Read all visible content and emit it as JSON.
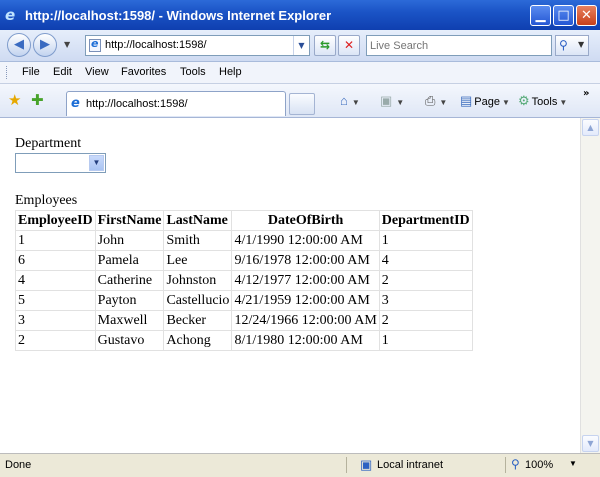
{
  "window": {
    "title": "http://localhost:1598/ - Windows Internet Explorer",
    "minimize_glyph": "▁",
    "maximize_glyph": "□",
    "close_glyph": "✕"
  },
  "address": {
    "url": "http://localhost:1598/",
    "search_placeholder": "Live Search"
  },
  "menu": {
    "file": "File",
    "edit": "Edit",
    "view": "View",
    "favorites": "Favorites",
    "tools": "Tools",
    "help": "Help"
  },
  "tab": {
    "label": "http://localhost:1598/"
  },
  "toolbar": {
    "page_label": "Page",
    "tools_label": "Tools"
  },
  "content": {
    "department_label": "Department",
    "department_selected": "",
    "employees_label": "Employees",
    "table": {
      "headers": [
        "EmployeeID",
        "FirstName",
        "LastName",
        "DateOfBirth",
        "DepartmentID"
      ],
      "rows": [
        [
          "1",
          "John",
          "Smith",
          "4/1/1990 12:00:00 AM",
          "1"
        ],
        [
          "6",
          "Pamela",
          "Lee",
          "9/16/1978 12:00:00 AM",
          "4"
        ],
        [
          "4",
          "Catherine",
          "Johnston",
          "4/12/1977 12:00:00 AM",
          "2"
        ],
        [
          "5",
          "Payton",
          "Castellucio",
          "4/21/1959 12:00:00 AM",
          "3"
        ],
        [
          "3",
          "Maxwell",
          "Becker",
          "12/24/1966 12:00:00 AM",
          "2"
        ],
        [
          "2",
          "Gustavo",
          "Achong",
          "8/1/1980 12:00:00 AM",
          "1"
        ]
      ]
    }
  },
  "status": {
    "text": "Done",
    "zone": "Local intranet",
    "zoom": "100%"
  },
  "colors": {
    "titlebar": "#1b54c6",
    "link_blue": "#1d6ed6"
  }
}
